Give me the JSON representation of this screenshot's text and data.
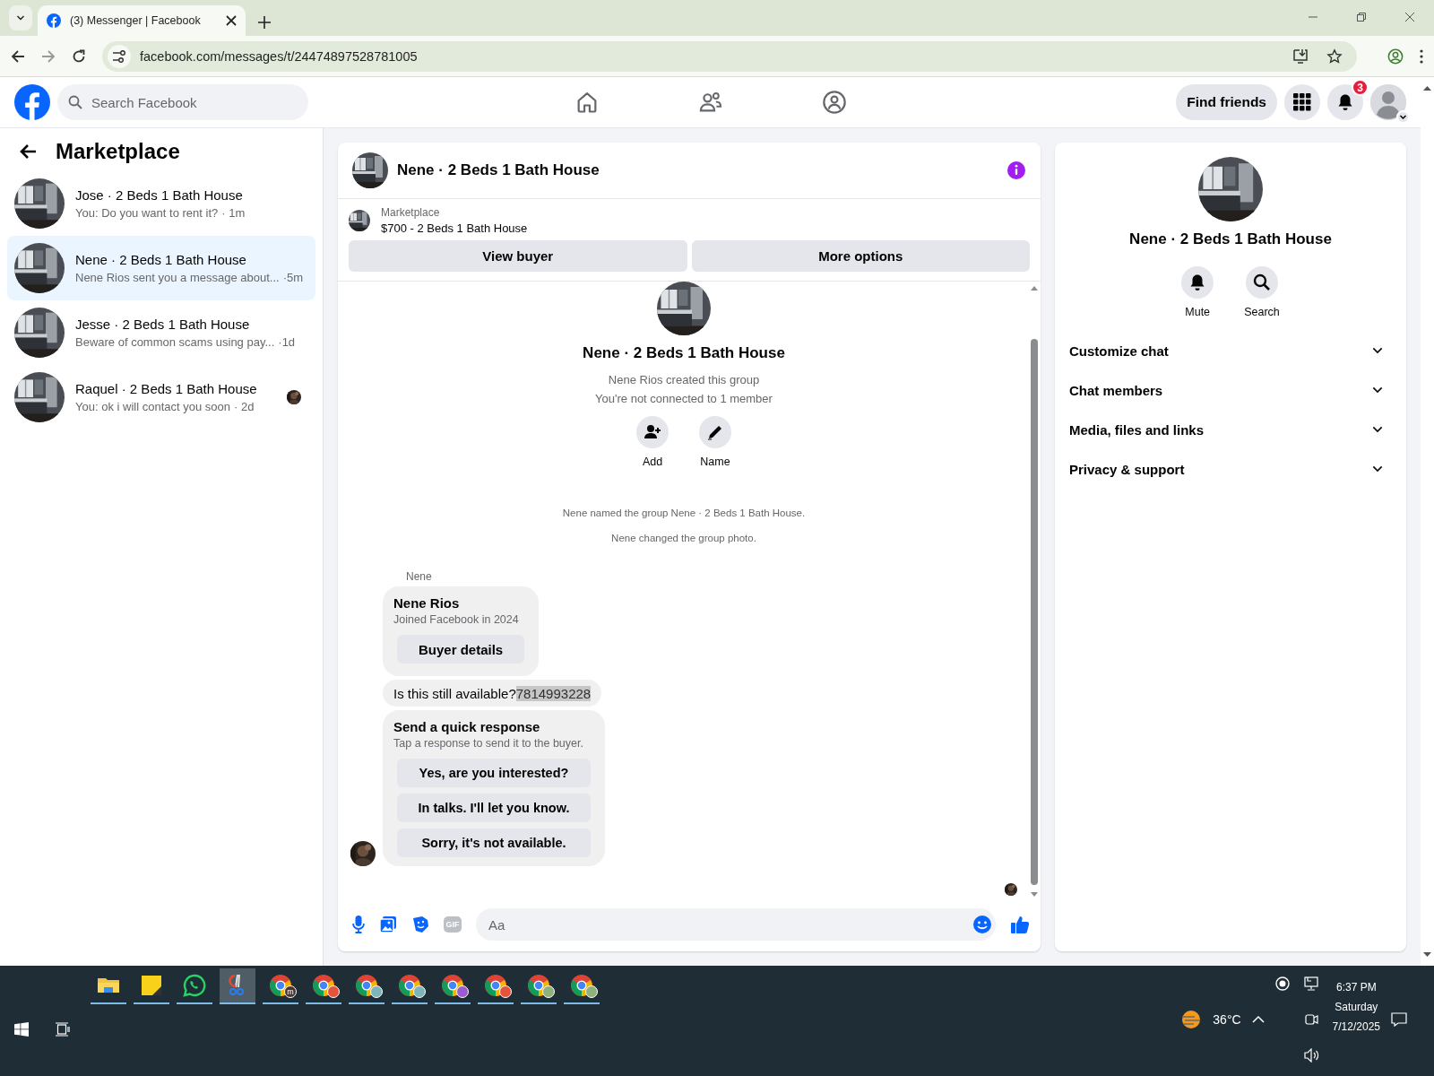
{
  "browser": {
    "tab_title": "(3) Messenger | Facebook",
    "url": "facebook.com/messages/t/24474897528781005"
  },
  "header": {
    "search_placeholder": "Search Facebook",
    "nav": [
      {
        "kind": "home"
      },
      {
        "kind": "friends"
      },
      {
        "kind": "groups"
      }
    ],
    "find_friends": "Find friends",
    "notification_count": "3"
  },
  "sidebar": {
    "title": "Marketplace",
    "chats": [
      {
        "name": "Jose · 2 Beds 1 Bath House",
        "preview": "You: Do you want to rent it?",
        "time": "· 1m",
        "selected": false,
        "seen": false
      },
      {
        "name": "Nene · 2 Beds 1 Bath House",
        "preview": "Nene Rios sent you a message about...",
        "time": "·5m",
        "selected": true,
        "seen": false
      },
      {
        "name": "Jesse · 2 Beds 1 Bath House",
        "preview": "Beware of common scams using pay...",
        "time": "·1d",
        "selected": false,
        "seen": false
      },
      {
        "name": "Raquel · 2 Beds 1 Bath House",
        "preview": "You: ok i will contact you soon",
        "time": "· 2d",
        "selected": false,
        "seen": true
      }
    ]
  },
  "chat": {
    "title": "Nene · 2 Beds 1 Bath House",
    "listing": {
      "label": "Marketplace",
      "title": "$700 - 2 Beds 1 Bath House"
    },
    "buttons": [
      "View buyer",
      "More options"
    ],
    "intro": {
      "name": "Nene · 2 Beds 1 Bath House",
      "lines": [
        "Nene Rios created this group",
        "You're not connected to 1 member"
      ],
      "actions": [
        {
          "kind": "add",
          "label": "Add"
        },
        {
          "kind": "name",
          "label": "Name"
        }
      ]
    },
    "events": [
      "Nene named the group Nene · 2 Beds 1 Bath House.",
      "Nene changed the group photo."
    ],
    "sender": "Nene",
    "profile_card": {
      "name": "Nene Rios",
      "subtitle": "Joined Facebook in 2024",
      "button": "Buyer details"
    },
    "message": {
      "text": "Is this still available?",
      "highlighted": "7814993228"
    },
    "quick_response": {
      "title": "Send a quick response",
      "subtitle": "Tap a response to send it to the buyer.",
      "options": [
        "Yes, are you interested?",
        "In talks. I'll let you know.",
        "Sorry, it's not available."
      ]
    },
    "composer": {
      "placeholder": "Aa",
      "gif_label": "GIF"
    }
  },
  "details": {
    "name": "Nene · 2 Beds 1 Bath House",
    "actions": [
      {
        "kind": "mute",
        "label": "Mute"
      },
      {
        "kind": "search",
        "label": "Search"
      }
    ],
    "sections": [
      {
        "label": "Customize chat",
        "expanded": false
      },
      {
        "label": "Chat members",
        "expanded": false
      },
      {
        "label": "Media, files and links",
        "expanded": false
      },
      {
        "label": "Privacy & support",
        "expanded": false
      }
    ]
  },
  "taskbar": {
    "apps": [
      {
        "kind": "folder",
        "selected": false
      },
      {
        "kind": "notes",
        "selected": false
      },
      {
        "kind": "chat",
        "selected": false
      },
      {
        "kind": "scissors",
        "selected": true
      },
      {
        "kind": "browser",
        "color": "#4a3630",
        "badge_text": "m",
        "selected": false
      },
      {
        "kind": "browser",
        "color": "#e5533c",
        "selected": false
      },
      {
        "kind": "browser",
        "color": "#7fb4bb",
        "selected": false
      },
      {
        "kind": "browser",
        "color": "#7fb4bb",
        "selected": false
      },
      {
        "kind": "browser",
        "color": "#9a5cd0",
        "selected": false
      },
      {
        "kind": "browser",
        "color": "#e5533c",
        "selected": false
      },
      {
        "kind": "browser",
        "color": "#8db27d",
        "selected": false
      },
      {
        "kind": "browser",
        "color": "#8db27d",
        "selected": false
      }
    ],
    "temperature": "36°C",
    "time": "6:37 PM",
    "day": "Saturday",
    "date": "7/12/2025"
  }
}
